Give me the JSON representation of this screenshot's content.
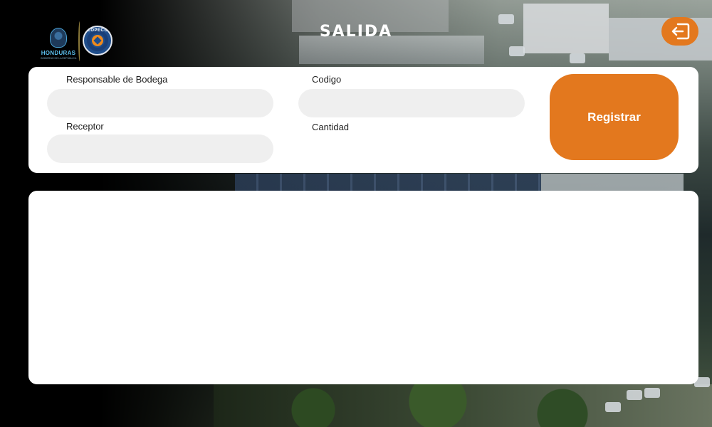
{
  "header": {
    "title": "SALIDA",
    "logo_honduras_text": "HONDURAS",
    "logo_honduras_tagline": "GOBIERNO DE LA REPÚBLICA",
    "logo_copeco_text": "COPECO",
    "exit_icon": "logout-arrow-icon"
  },
  "form": {
    "responsable": {
      "label": "Responsable de Bodega",
      "value": "",
      "placeholder": ""
    },
    "codigo": {
      "label": "Codigo",
      "value": "",
      "placeholder": ""
    },
    "receptor": {
      "label": "Receptor",
      "value": "",
      "placeholder": ""
    },
    "cantidad": {
      "label": "Cantidad"
    },
    "register_label": "Registrar"
  },
  "colors": {
    "accent": "#e3781e",
    "input_bg": "#efefef",
    "card_bg": "#ffffff"
  }
}
